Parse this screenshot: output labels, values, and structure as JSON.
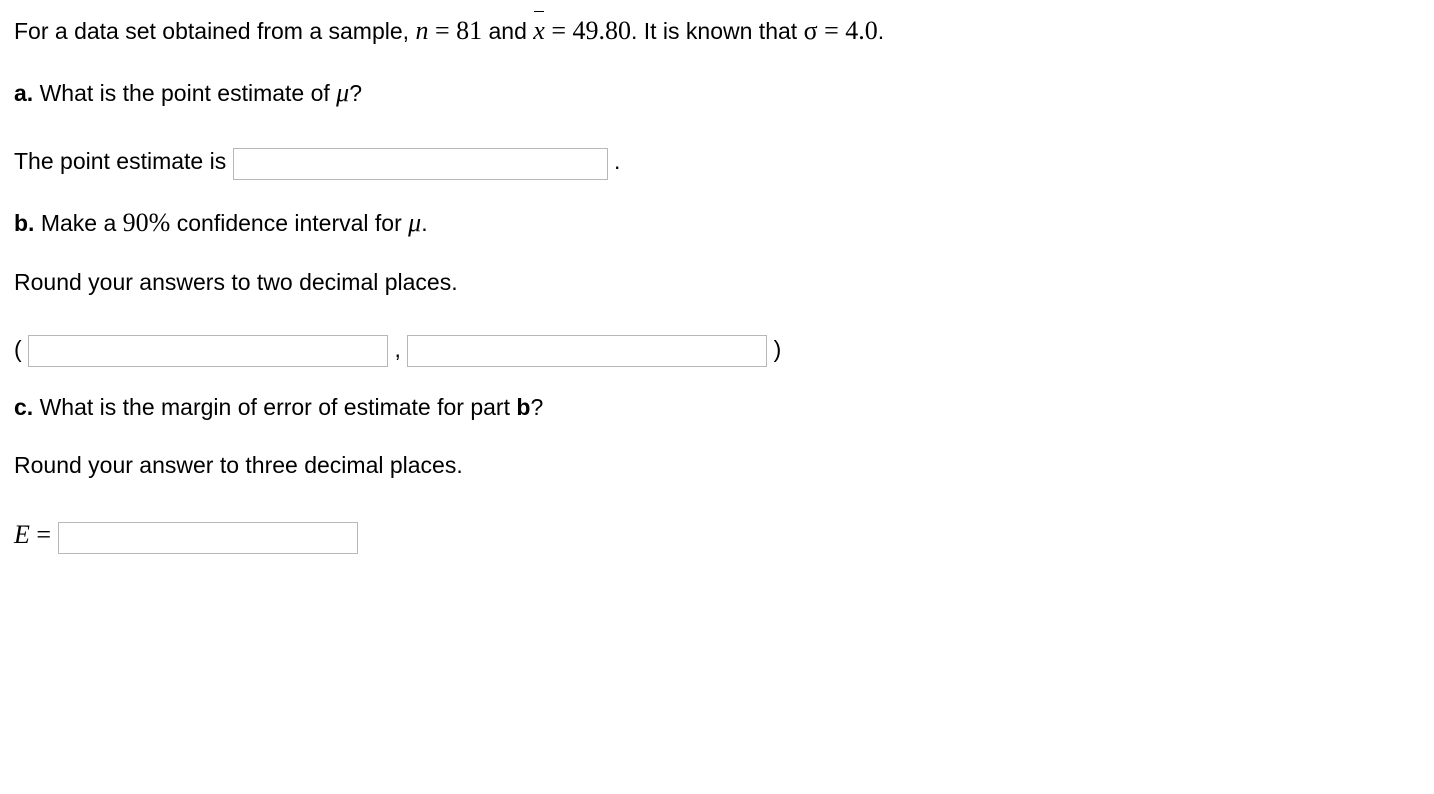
{
  "problem": {
    "intro_1": "For a data set obtained from a sample, ",
    "n_var": "n",
    "eq": " = ",
    "n_val": "81",
    "and": " and ",
    "xbar_var": "x",
    "xbar_val": "49.80",
    "known_1": ". It is known that ",
    "sigma_var": "σ",
    "sigma_val": "4.0",
    "period": "."
  },
  "parts": {
    "a": {
      "label": "a.",
      "text": " What is the point estimate of ",
      "mu": "μ",
      "q": "?"
    },
    "a_ans": {
      "lead": "The point estimate is ",
      "trail": "."
    },
    "b": {
      "label": "b.",
      "text": " Make a ",
      "pct": "90%",
      "text2": " confidence interval for ",
      "mu": "μ",
      "p": "."
    },
    "b_round": "Round your answers to two decimal places.",
    "b_paren": {
      "open": "(",
      "comma": ",",
      "close": ")"
    },
    "c": {
      "label": "c.",
      "text": " What is the margin of error of estimate for part ",
      "bref": "b",
      "q": "?"
    },
    "c_round": "Round your answer to three decimal places.",
    "c_ans": {
      "E": "E",
      "eq": " = "
    }
  }
}
